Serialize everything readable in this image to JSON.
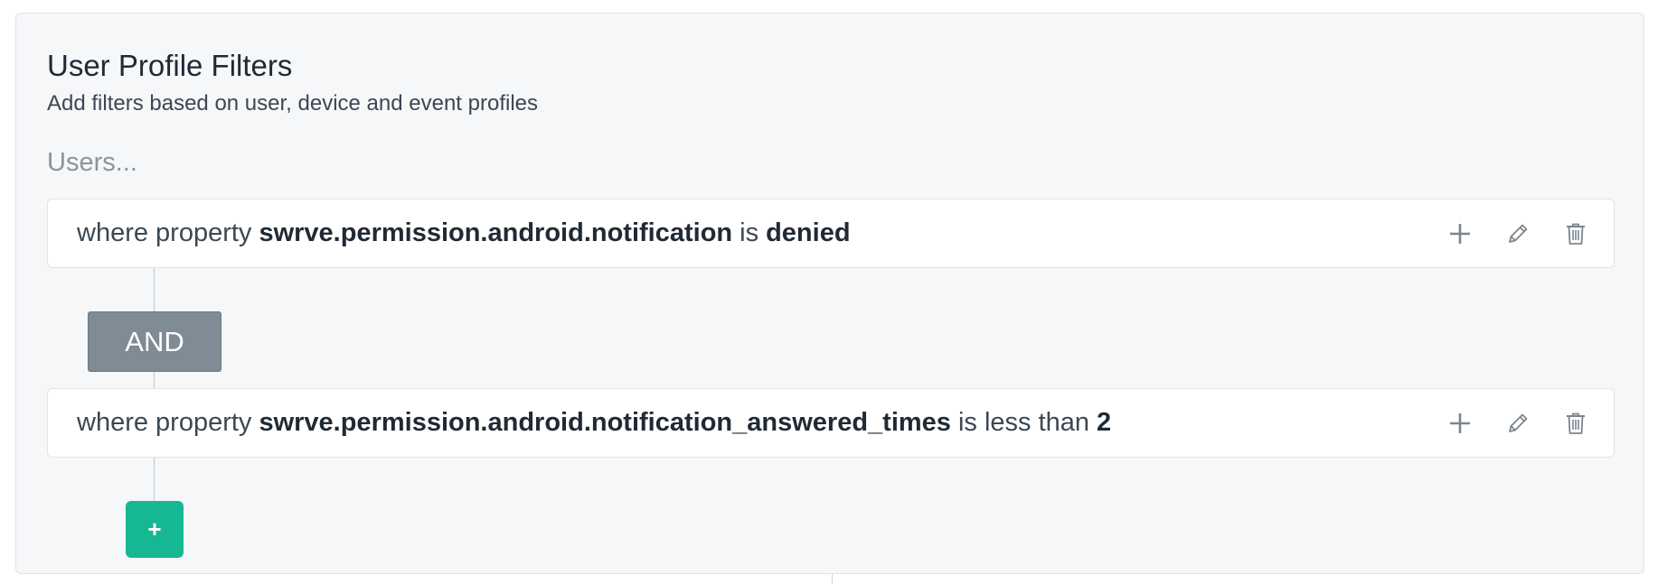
{
  "panel": {
    "title": "User Profile Filters",
    "subtitle": "Add filters based on user, device and event profiles",
    "users_label": "Users..."
  },
  "rules": [
    {
      "prefix": "where property",
      "property": "swrve.permission.android.notification",
      "operator": "is",
      "value": "denied"
    },
    {
      "prefix": "where property",
      "property": "swrve.permission.android.notification_answered_times",
      "operator": "is less than",
      "value": "2"
    }
  ],
  "connector": {
    "label": "AND"
  },
  "add_button": {
    "label": "+"
  },
  "colors": {
    "panel_bg": "#f6f7f9",
    "and_badge": "#7f8c96",
    "add_button": "#16b894",
    "icon": "#7a858f"
  },
  "icons": {
    "add": "plus-icon",
    "edit": "pencil-icon",
    "delete": "trash-icon"
  }
}
